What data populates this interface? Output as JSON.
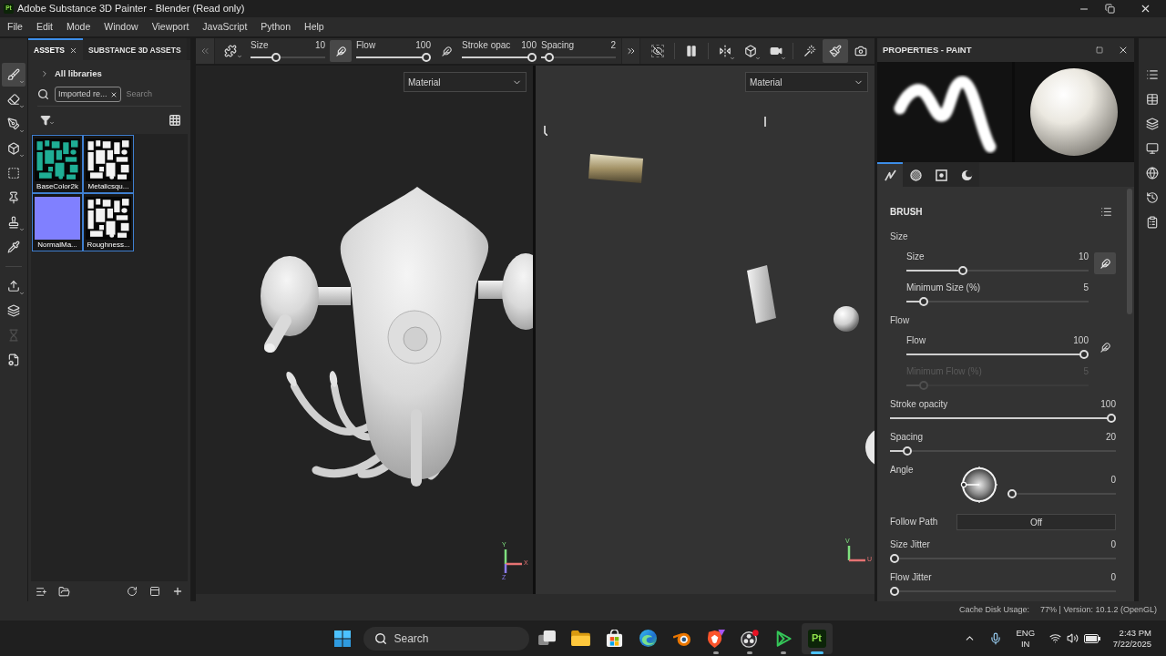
{
  "window": {
    "icon_label": "Pt",
    "title": "Adobe Substance 3D Painter - Blender (Read only)"
  },
  "menu": [
    "File",
    "Edit",
    "Mode",
    "Window",
    "Viewport",
    "JavaScript",
    "Python",
    "Help"
  ],
  "tools": [
    {
      "selected": true,
      "disabled": false,
      "dropdown": true
    },
    {
      "selected": false,
      "disabled": false,
      "dropdown": true
    },
    {
      "selected": false,
      "disabled": false,
      "dropdown": true
    },
    {
      "selected": false,
      "disabled": false,
      "dropdown": true
    },
    {
      "selected": false,
      "disabled": false,
      "dropdown": false
    },
    {
      "selected": false,
      "disabled": false,
      "dropdown": false
    },
    {
      "selected": false,
      "disabled": false,
      "dropdown": true
    },
    {
      "selected": false,
      "disabled": false,
      "dropdown": false
    }
  ],
  "tools_secondary": [
    {
      "selected": false,
      "disabled": false,
      "dropdown": true
    },
    {
      "selected": false,
      "disabled": false,
      "dropdown": false
    },
    {
      "selected": false,
      "disabled": true,
      "dropdown": false
    },
    {
      "selected": false,
      "disabled": false,
      "dropdown": false
    }
  ],
  "assets": {
    "tabs": [
      {
        "label": "ASSETS",
        "selected": true,
        "closable": true
      },
      {
        "label": "SUBSTANCE 3D ASSETS",
        "selected": false,
        "closable": false
      }
    ],
    "library": "All libraries",
    "filter_chip": "Imported re...",
    "search": {
      "placeholder": "Search"
    },
    "items": [
      {
        "name": "BaseColor2k",
        "kind": "map",
        "color": "#1fae95",
        "selected": true
      },
      {
        "name": "Metalicsqu...",
        "kind": "map",
        "color": "#f2f2f2",
        "selected": true
      },
      {
        "name": "NormalMa...",
        "kind": "flat",
        "color": "#8080ff",
        "selected": true
      },
      {
        "name": "Roughness...",
        "kind": "map",
        "color": "#f2f2f2",
        "selected": true
      }
    ]
  },
  "brush_toolbar": {
    "sliders": [
      {
        "label": "Size",
        "reading": "10",
        "level": 0.32,
        "pen": {
          "on": true
        }
      },
      {
        "label": "Flow",
        "reading": "100",
        "level": 1,
        "pen": {
          "on": false
        }
      },
      {
        "label": "Stroke opac",
        "reading": "100",
        "level": 1
      },
      {
        "label": "Spacing",
        "reading": "2",
        "level": 0.05
      }
    ]
  },
  "viewport_tools": [
    {
      "selected": false,
      "dropdown": false
    },
    {
      "selected": false,
      "dropdown": false
    },
    {
      "selected": false,
      "dropdown": true
    },
    {
      "selected": false,
      "dropdown": true
    },
    {
      "selected": false,
      "dropdown": true
    },
    {
      "selected": false,
      "dropdown": false
    },
    {
      "selected": true,
      "dropdown": false
    },
    {
      "selected": false,
      "dropdown": false
    }
  ],
  "viewports": [
    {
      "kind": "model",
      "mode": "Material",
      "axes": [
        "Y",
        "X",
        "Z"
      ]
    },
    {
      "kind": "uv",
      "mode": "Material",
      "axes": [
        "V",
        "U"
      ]
    }
  ],
  "properties": {
    "title": "PROPERTIES - PAINT",
    "tabs": [
      {
        "selected": true
      },
      {
        "selected": false
      },
      {
        "selected": false
      },
      {
        "selected": false
      }
    ],
    "section": "BRUSH",
    "rows": [
      {
        "kind": "group",
        "label": "Size",
        "children": [
          {
            "kind": "slider",
            "label": "Size",
            "reading": "10",
            "level": 0.3,
            "disabled": false,
            "pen": {
              "on": true
            }
          },
          {
            "kind": "slider",
            "label": "Minimum Size (%)",
            "reading": "5",
            "level": 0.075,
            "disabled": false
          }
        ]
      },
      {
        "kind": "group",
        "label": "Flow",
        "children": [
          {
            "kind": "slider",
            "label": "Flow",
            "reading": "100",
            "level": 1,
            "disabled": false,
            "pen": {
              "on": false
            }
          },
          {
            "kind": "slider",
            "label": "Minimum Flow (%)",
            "reading": "5",
            "level": 0.075,
            "disabled": true
          }
        ]
      },
      {
        "kind": "slider",
        "label": "Stroke opacity",
        "reading": "100",
        "level": 1,
        "disabled": false
      },
      {
        "kind": "slider",
        "label": "Spacing",
        "reading": "20",
        "level": 0.06,
        "disabled": false
      },
      {
        "kind": "dial",
        "label": "Angle",
        "reading": "0",
        "level": 0
      },
      {
        "kind": "toggle",
        "label": "Follow Path",
        "value": "Off"
      },
      {
        "kind": "slider",
        "label": "Size Jitter",
        "reading": "0",
        "level": 0,
        "disabled": false
      },
      {
        "kind": "slider",
        "label": "Flow Jitter",
        "reading": "0",
        "level": 0,
        "disabled": false
      }
    ]
  },
  "status_bar": {
    "cache_label": "Cache Disk Usage:",
    "details": "77% | Version: 10.1.2 (OpenGL)"
  },
  "taskbar": {
    "search": {
      "placeholder": "Search"
    },
    "apps": [
      {
        "running": false,
        "selected": false
      },
      {
        "running": false,
        "selected": false
      },
      {
        "running": false,
        "selected": false
      },
      {
        "running": false,
        "selected": false
      },
      {
        "running": false,
        "selected": false
      },
      {
        "running": true,
        "selected": false
      },
      {
        "running": true,
        "selected": false
      },
      {
        "running": true,
        "selected": false
      },
      {
        "running": true,
        "selected": true,
        "label": "Pt"
      }
    ],
    "tray": {
      "language": "ENG",
      "region": "IN",
      "time": "2:43 PM",
      "date": "7/22/2025"
    }
  }
}
